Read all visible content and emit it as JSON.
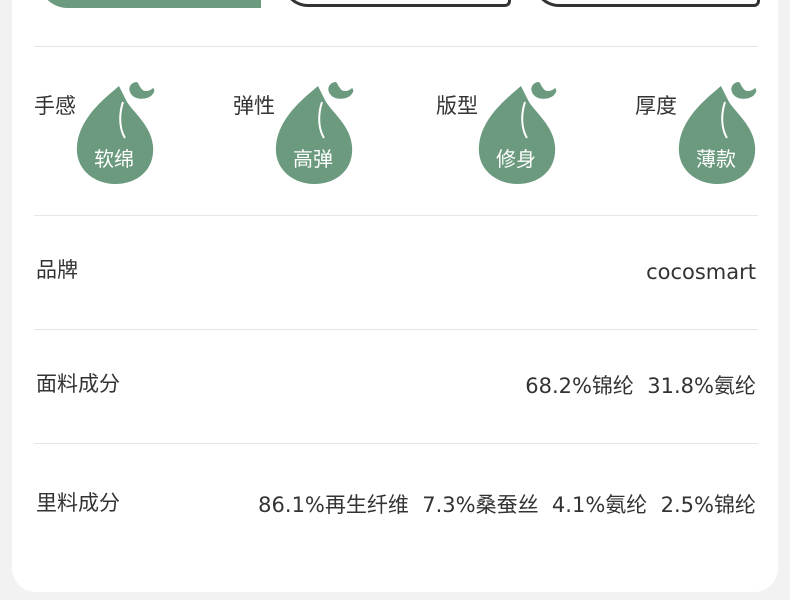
{
  "colors": {
    "accent": "#6b9a7e",
    "text": "#333333",
    "divider": "#e6e6e6"
  },
  "feel": [
    {
      "label": "手感",
      "value": "软绵"
    },
    {
      "label": "弹性",
      "value": "高弹"
    },
    {
      "label": "版型",
      "value": "修身"
    },
    {
      "label": "厚度",
      "value": "薄款"
    }
  ],
  "specs": [
    {
      "label": "品牌",
      "value": "cocosmart"
    },
    {
      "label": "面料成分",
      "value": "68.2%锦纶  31.8%氨纶"
    },
    {
      "label": "里料成分",
      "value": "86.1%再生纤维  7.3%桑蚕丝  4.1%氨纶  2.5%锦纶"
    }
  ]
}
